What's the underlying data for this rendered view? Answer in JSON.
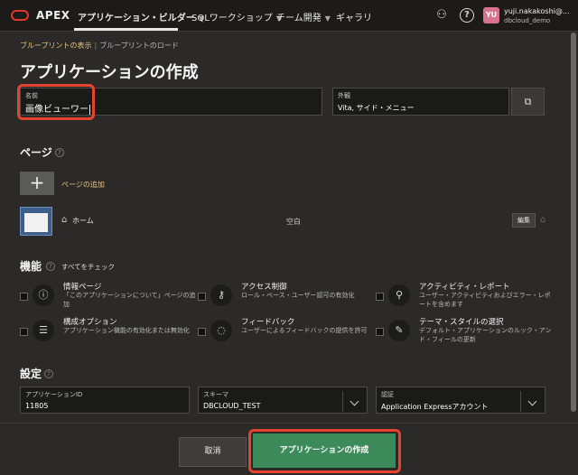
{
  "topbar": {
    "brand": "APEX",
    "nav": [
      {
        "label": "アプリケーション・ビルダー"
      },
      {
        "label": "SQLワークショップ"
      },
      {
        "label": "チーム開発"
      },
      {
        "label": "ギャラリ"
      }
    ],
    "user": {
      "initials": "YU",
      "name": "yuji.nakakoshi@...",
      "workspace": "dbcloud_demo"
    }
  },
  "breadcrumbs": [
    "ブループリントの表示",
    "ブループリントのロード"
  ],
  "page_title": "アプリケーションの作成",
  "name_field": {
    "label": "名前",
    "value": "画像ビューワー"
  },
  "appearance_field": {
    "label": "外観",
    "value": "Vita, サイド・メニュー"
  },
  "pages_section": {
    "title": "ページ",
    "add_label": "ページの追加",
    "rows": [
      {
        "name": "ホーム",
        "template": "空白",
        "edit_label": "編集"
      }
    ]
  },
  "features_section": {
    "title": "機能",
    "check_all": "すべてをチェック",
    "items": [
      {
        "title": "情報ページ",
        "desc": "「このアプリケーションについて」ページの追加",
        "icon": "info-icon"
      },
      {
        "title": "アクセス制御",
        "desc": "ロール・ベース・ユーザー認可の有効化",
        "icon": "key-icon"
      },
      {
        "title": "アクティビティ・レポート",
        "desc": "ユーザー・アクティビティおよびエラー・レポートを含めます",
        "icon": "user-report-icon"
      },
      {
        "title": "構成オプション",
        "desc": "アプリケーション機能の有効化または無効化",
        "icon": "sliders-icon"
      },
      {
        "title": "フィードバック",
        "desc": "ユーザーによるフィードバックの提供を許可",
        "icon": "chat-icon"
      },
      {
        "title": "テーマ・スタイルの選択",
        "desc": "デフォルト・アプリケーションのルック・アンド・フィールの更新",
        "icon": "brush-icon"
      }
    ]
  },
  "settings_section": {
    "title": "設定",
    "fields": [
      {
        "label": "アプリケーションID",
        "value": "11805"
      },
      {
        "label": "スキーマ",
        "value": "DBCLOUD_TEST"
      },
      {
        "label": "認証",
        "value": "Application Expressアカウント"
      }
    ]
  },
  "footer": {
    "cancel": "取消",
    "create": "アプリケーションの作成"
  },
  "colors": {
    "accent": "#e7c27a",
    "primary": "#3d8a5a",
    "highlight": "#e5432d",
    "brand": "#e2382b"
  }
}
